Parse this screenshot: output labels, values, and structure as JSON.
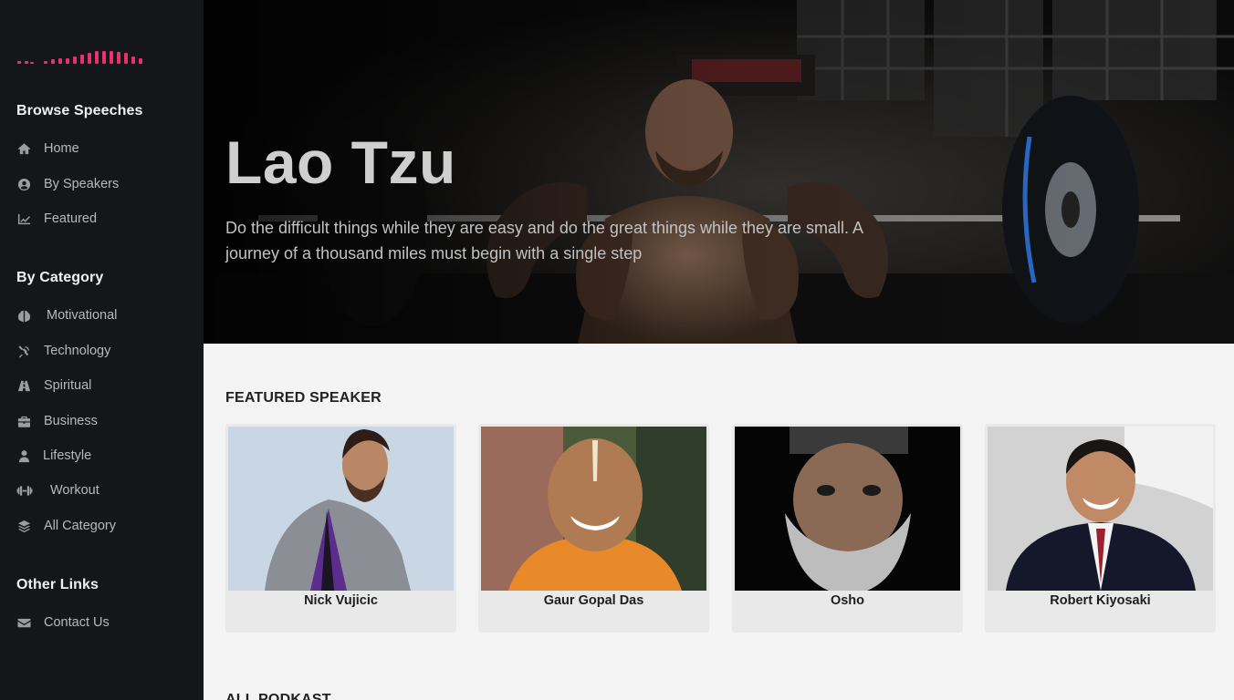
{
  "sidebar": {
    "sections": [
      {
        "heading": "Browse Speeches",
        "items": [
          {
            "label": "Home",
            "icon": "home-icon"
          },
          {
            "label": "By Speakers",
            "icon": "user-circle-icon"
          },
          {
            "label": "Featured",
            "icon": "chart-line-icon"
          }
        ]
      },
      {
        "heading": "By Category",
        "items": [
          {
            "label": "Motivational",
            "icon": "brain-icon"
          },
          {
            "label": "Technology",
            "icon": "satellite-icon"
          },
          {
            "label": "Spiritual",
            "icon": "road-icon"
          },
          {
            "label": "Business",
            "icon": "briefcase-icon"
          },
          {
            "label": "Lifestyle",
            "icon": "user-icon"
          },
          {
            "label": "Workout",
            "icon": "dumbbell-icon"
          },
          {
            "label": "All Category",
            "icon": "layers-icon"
          }
        ]
      },
      {
        "heading": "Other Links",
        "items": [
          {
            "label": "Contact Us",
            "icon": "envelope-icon"
          }
        ]
      }
    ]
  },
  "hero": {
    "title": "Lao Tzu",
    "quote": "Do the difficult things while they are easy and do the great things while they are small. A journey of a thousand miles must begin with a single step"
  },
  "featured": {
    "title": "FEATURED SPEAKER",
    "speakers": [
      {
        "name": "Nick Vujicic"
      },
      {
        "name": "Gaur Gopal Das"
      },
      {
        "name": "Osho"
      },
      {
        "name": "Robert Kiyosaki"
      }
    ]
  },
  "all_podcast": {
    "title": "ALL PODKAST"
  },
  "colors": {
    "sidebar_bg": "#15161a",
    "accent": "#e8326d",
    "page_bg": "#f4f4f4"
  }
}
